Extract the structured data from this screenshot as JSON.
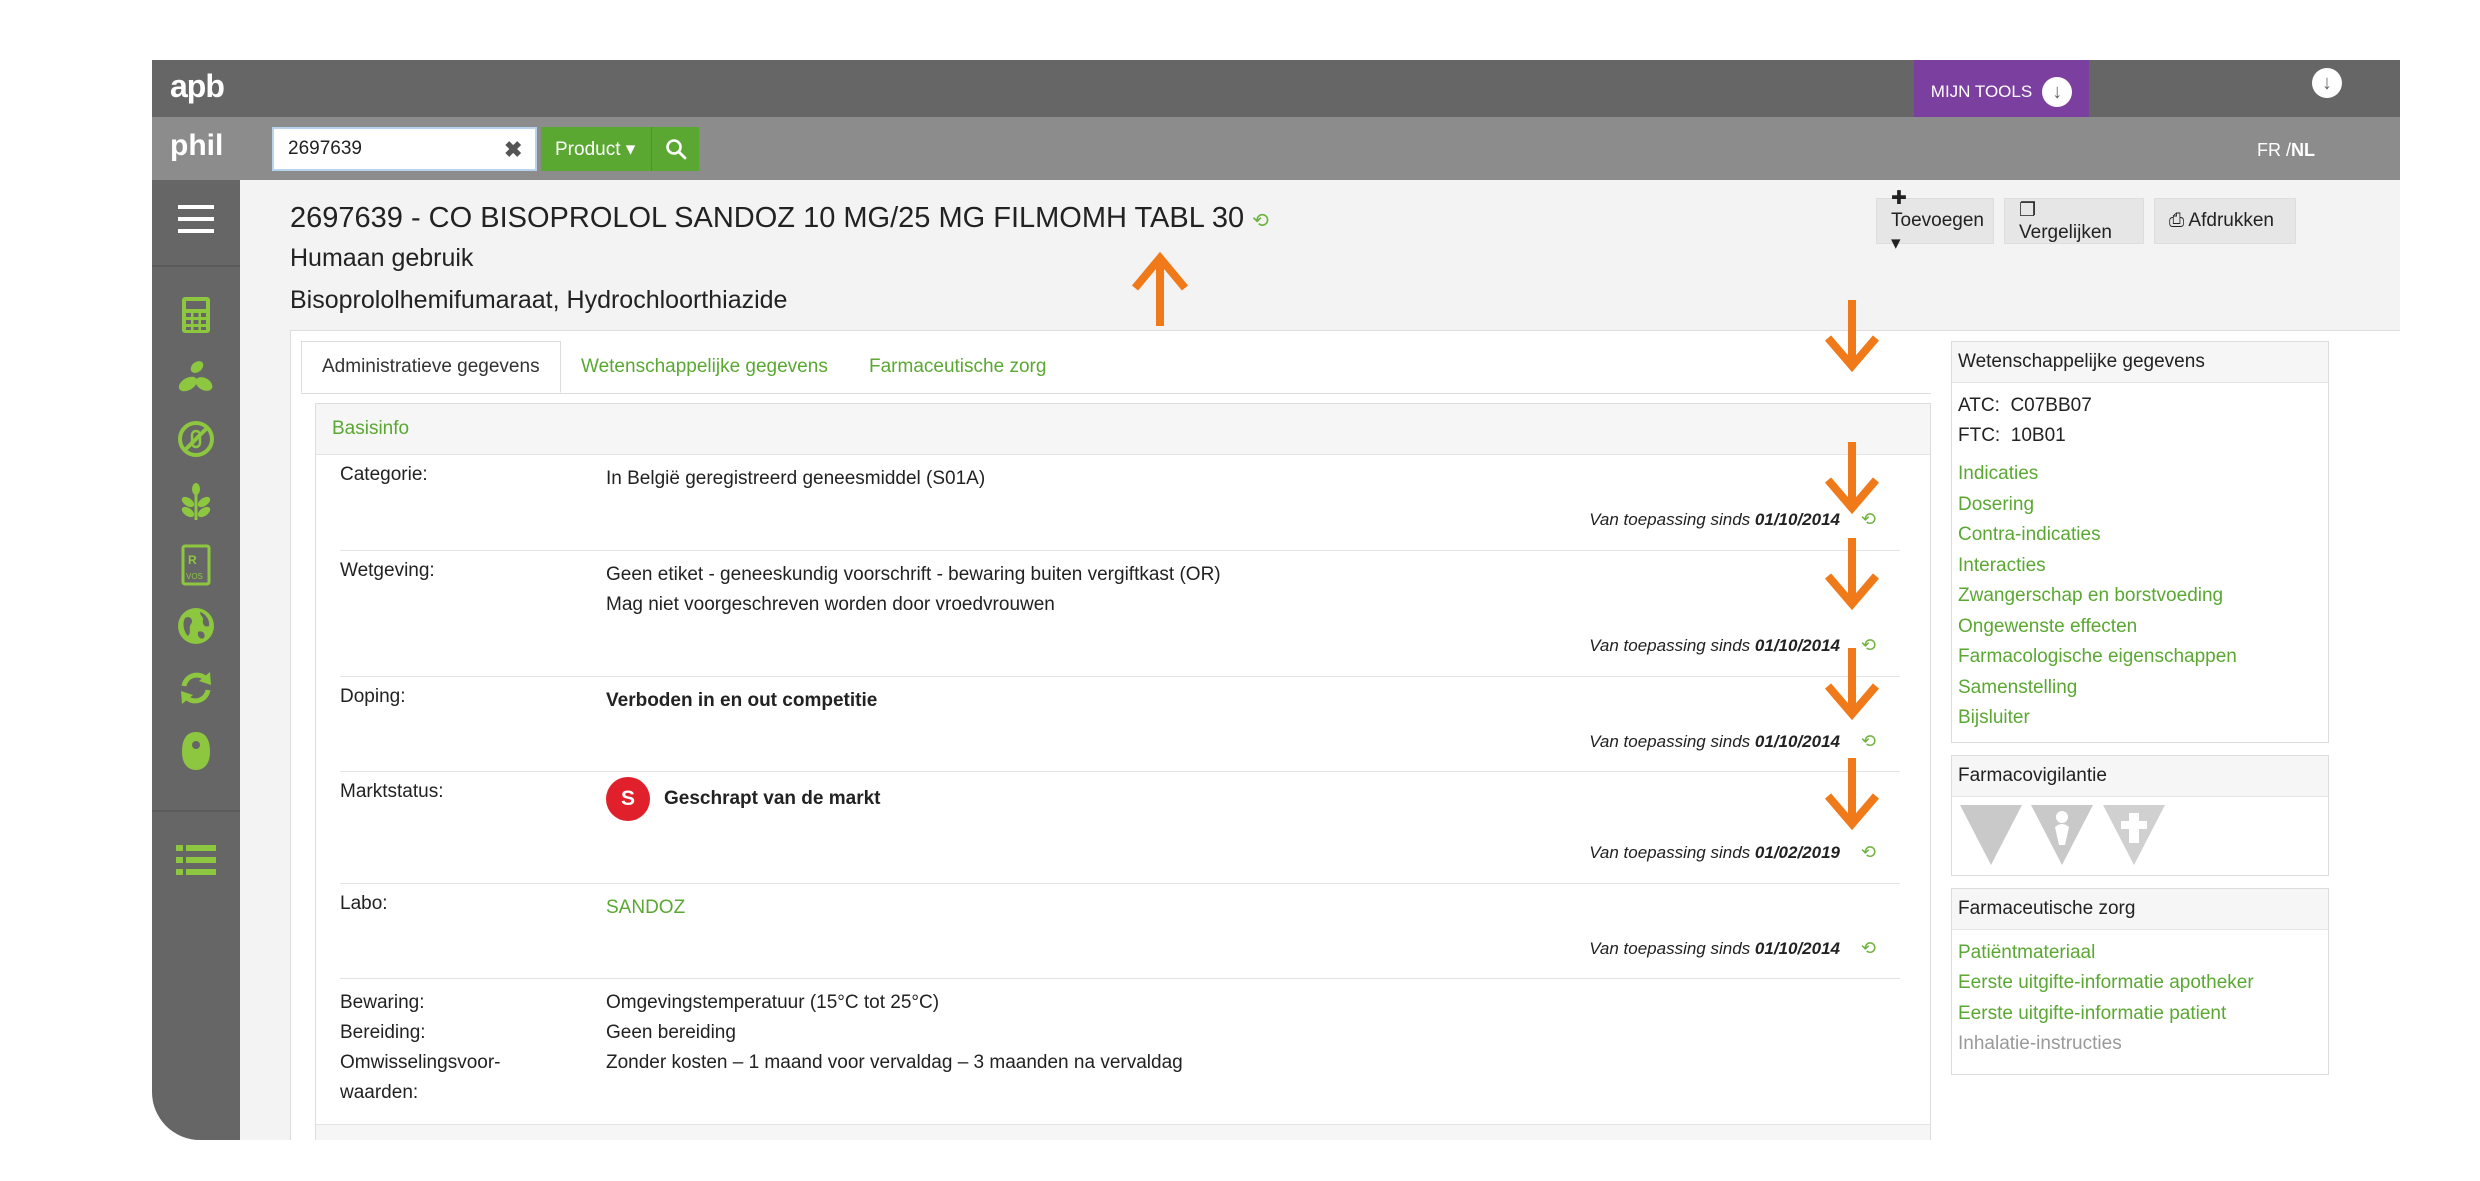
{
  "topbar": {
    "logo": "apb",
    "mijn_tools": "MIJN TOOLS",
    "download_glyph": "↓"
  },
  "searchbar": {
    "logo": "phil",
    "search_value": "2697639",
    "clear_glyph": "✖",
    "product_label": "Product ▾",
    "search_glyph": "⚲",
    "lang_fr": "FR /",
    "lang_nl": "NL"
  },
  "sidebar": {
    "icons": [
      "menu-icon",
      "calculator-icon",
      "pills-icon",
      "prohibited-icon",
      "plant-icon",
      "rx-vos-icon",
      "globe-icon",
      "refresh-icon",
      "ostomy-icon",
      "list-icon"
    ]
  },
  "header": {
    "title": "2697639 - CO BISOPROLOL SANDOZ 10 MG/25 MG FILMOMH TABL 30",
    "hist_glyph": "⟲",
    "subtitle1": "Humaan gebruik",
    "subtitle2": "Bisoprololhemifumaraat, Hydrochloorthiazide",
    "toevoegen": "✚ Toevoegen ▾",
    "vergelijken": "❐ Vergelijken",
    "afdrukken": "⎙ Afdrukken"
  },
  "tabs": [
    "Administratieve gegevens",
    "Wetenschappelijke gegevens",
    "Farmaceutische zorg"
  ],
  "basisinfo": {
    "heading": "Basisinfo",
    "since_prefix": "Van toepassing sinds",
    "rows": [
      {
        "label": "Categorie:",
        "value": "In België geregistreerd geneesmiddel (S01A)",
        "date": "01/10/2014"
      },
      {
        "label": "Wetgeving:",
        "value1": "Geen etiket - geneeskundig voorschrift - bewaring buiten vergiftkast (OR)",
        "value2": "Mag niet voorgeschreven worden door vroedvrouwen",
        "date": "01/10/2014"
      },
      {
        "label": "Doping:",
        "value": "Verboden in en out competitie",
        "date": "01/10/2014"
      },
      {
        "label": "Marktstatus:",
        "badge": "S",
        "value": "Geschrapt van de markt",
        "date": "01/02/2019"
      },
      {
        "label": "Labo:",
        "value": "SANDOZ",
        "date": "01/10/2014"
      }
    ],
    "bewaring_label": "Bewaring:",
    "bewaring_value": "Omgevingstemperatuur (15°C tot 25°C)",
    "bereiding_label": "Bereiding:",
    "bereiding_value": "Geen bereiding",
    "omw_label1": "Omwisselingsvoor-",
    "omw_label2": "waarden:",
    "omw_value": "Zonder kosten – 1 maand voor vervaldag – 3 maanden na vervaldag"
  },
  "right": {
    "wet_head": "Wetenschappelijke gegevens",
    "atc_label": "ATC:",
    "atc_value": "C07BB07",
    "ftc_label": "FTC:",
    "ftc_value": "10B01",
    "wet_links": [
      "Indicaties",
      "Dosering",
      "Contra-indicaties",
      "Interacties",
      "Zwangerschap en borstvoeding",
      "Ongewenste effecten",
      "Farmacologische eigenschappen",
      "Samenstelling",
      "Bijsluiter"
    ],
    "fv_head": "Farmacovigilantie",
    "fz_head": "Farmaceutische zorg",
    "fz_links": [
      "Patiëntmateriaal",
      "Eerste uitgifte-informatie apotheker",
      "Eerste uitgifte-informatie patient"
    ],
    "fz_disabled": "Inhalatie-instructies"
  },
  "colors": {
    "accent_green": "#5aa832",
    "purple": "#7b3fa0",
    "orange_arrow": "#f07a1a",
    "badge_red": "#e0202a"
  }
}
